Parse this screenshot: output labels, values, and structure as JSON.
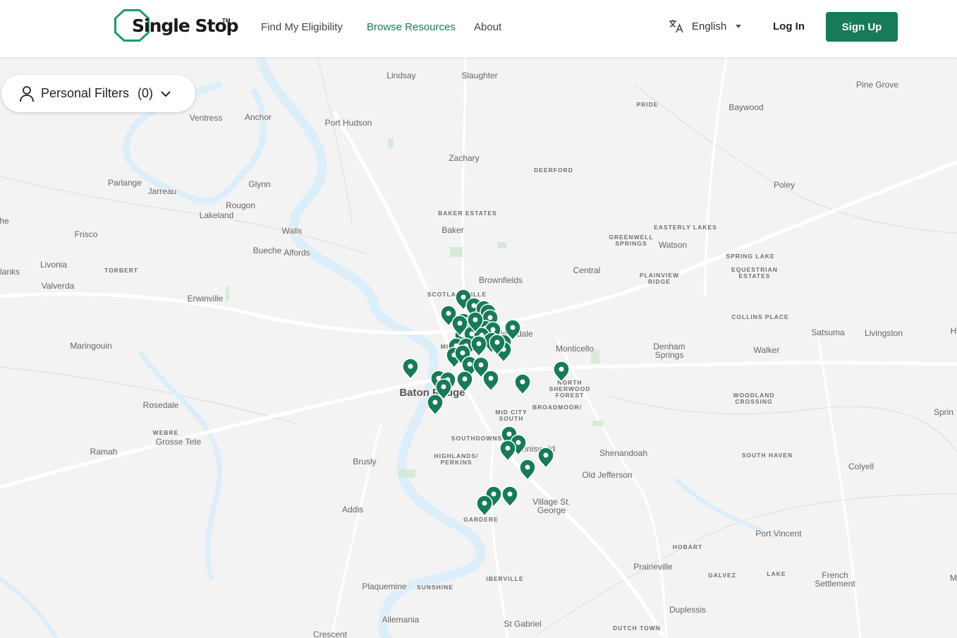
{
  "brand": {
    "name": "Single Stop",
    "tm": "TM"
  },
  "nav": [
    {
      "label": "Find My Eligibility"
    },
    {
      "label": "Browse Resources"
    },
    {
      "label": "About"
    }
  ],
  "language": {
    "label": "English",
    "icon": "translate-icon"
  },
  "auth": {
    "login": "Log In",
    "signup": "Sign Up"
  },
  "filters": {
    "label": "Personal Filters",
    "count": "(0)",
    "icon": "person-icon"
  },
  "colors": {
    "accent": "#177a58",
    "pin": "#177a58",
    "water": "#dbeefa",
    "land": "#f3f3f3",
    "road": "#ffffff"
  },
  "map": {
    "places": [
      {
        "name": "Lindsay",
        "kind": "town"
      },
      {
        "name": "Slaughter",
        "kind": "town"
      },
      {
        "name": "Pine Grove",
        "kind": "town"
      },
      {
        "name": "PRIDE",
        "kind": "area"
      },
      {
        "name": "Baywood",
        "kind": "town"
      },
      {
        "name": "Ventress",
        "kind": "town"
      },
      {
        "name": "Anchor",
        "kind": "town"
      },
      {
        "name": "Port Hudson",
        "kind": "town"
      },
      {
        "name": "Zachary",
        "kind": "town"
      },
      {
        "name": "DEERFORD",
        "kind": "area"
      },
      {
        "name": "Parlange",
        "kind": "town"
      },
      {
        "name": "Jarreau",
        "kind": "town"
      },
      {
        "name": "Glynn",
        "kind": "town"
      },
      {
        "name": "Poley",
        "kind": "town"
      },
      {
        "name": "Rougon",
        "kind": "town"
      },
      {
        "name": "Lakeland",
        "kind": "town"
      },
      {
        "name": "BAKER ESTATES",
        "kind": "area"
      },
      {
        "name": "he",
        "kind": "town"
      },
      {
        "name": "Frisco",
        "kind": "town"
      },
      {
        "name": "Walls",
        "kind": "town"
      },
      {
        "name": "Baker",
        "kind": "town"
      },
      {
        "name": "EASTERLY LAKES",
        "kind": "area"
      },
      {
        "name": "GREENWELL",
        "kind": "area"
      },
      {
        "name": "SPRINGS",
        "kind": "area"
      },
      {
        "name": "Watson",
        "kind": "town"
      },
      {
        "name": "Bueche",
        "kind": "town"
      },
      {
        "name": "Alfords",
        "kind": "town"
      },
      {
        "name": "SPRING LAKE",
        "kind": "area"
      },
      {
        "name": "Livonia",
        "kind": "town"
      },
      {
        "name": "lanks",
        "kind": "town"
      },
      {
        "name": "TORBERT",
        "kind": "area"
      },
      {
        "name": "Central",
        "kind": "town"
      },
      {
        "name": "EQUESTRIAN",
        "kind": "area"
      },
      {
        "name": "ESTATES",
        "kind": "area"
      },
      {
        "name": "Brownfields",
        "kind": "town"
      },
      {
        "name": "PLAINVIEW",
        "kind": "area"
      },
      {
        "name": "RIDGE",
        "kind": "area"
      },
      {
        "name": "Valverda",
        "kind": "town"
      },
      {
        "name": "SCOTLANDVILLE",
        "kind": "area"
      },
      {
        "name": "Erwinville",
        "kind": "town"
      },
      {
        "name": "COLLINS PLACE",
        "kind": "area"
      },
      {
        "name": "Satsuma",
        "kind": "town"
      },
      {
        "name": "Livingston",
        "kind": "town"
      },
      {
        "name": "H",
        "kind": "town"
      },
      {
        "name": "Merrydale",
        "kind": "town"
      },
      {
        "name": "Maringouin",
        "kind": "town"
      },
      {
        "name": "Monticello",
        "kind": "town"
      },
      {
        "name": "Denham",
        "kind": "town"
      },
      {
        "name": "Springs",
        "kind": "town"
      },
      {
        "name": "Walker",
        "kind": "town"
      },
      {
        "name": "MID",
        "kind": "area"
      },
      {
        "name": "NORTH",
        "kind": "area"
      },
      {
        "name": "SHERWOOD",
        "kind": "area"
      },
      {
        "name": "FOREST",
        "kind": "area"
      },
      {
        "name": "Baton Rouge",
        "kind": "city"
      },
      {
        "name": "WOODLAND",
        "kind": "area"
      },
      {
        "name": "CROSSING",
        "kind": "area"
      },
      {
        "name": "Rosedale",
        "kind": "town"
      },
      {
        "name": "MID CITY",
        "kind": "area"
      },
      {
        "name": "SOUTH",
        "kind": "area"
      },
      {
        "name": "BROADMOOR/",
        "kind": "area"
      },
      {
        "name": "Sprin",
        "kind": "town"
      },
      {
        "name": "WEBRE",
        "kind": "area"
      },
      {
        "name": "Grosse Tete",
        "kind": "town"
      },
      {
        "name": "SOUTHDOWNS",
        "kind": "area"
      },
      {
        "name": "Inniswold",
        "kind": "town"
      },
      {
        "name": "Ramah",
        "kind": "town"
      },
      {
        "name": "Shenandoah",
        "kind": "town"
      },
      {
        "name": "HIGHLANDS/",
        "kind": "area"
      },
      {
        "name": "PERKINS",
        "kind": "area"
      },
      {
        "name": "SOUTH HAVEN",
        "kind": "area"
      },
      {
        "name": "Brusly",
        "kind": "town"
      },
      {
        "name": "Colyell",
        "kind": "town"
      },
      {
        "name": "Old Jefferson",
        "kind": "town"
      },
      {
        "name": "Village St.",
        "kind": "town"
      },
      {
        "name": "George",
        "kind": "town"
      },
      {
        "name": "Addis",
        "kind": "town"
      },
      {
        "name": "GARDERE",
        "kind": "area"
      },
      {
        "name": "Port Vincent",
        "kind": "town"
      },
      {
        "name": "HOBART",
        "kind": "area"
      },
      {
        "name": "Prairieville",
        "kind": "town"
      },
      {
        "name": "GALVEZ",
        "kind": "area"
      },
      {
        "name": "LAKE",
        "kind": "area"
      },
      {
        "name": "French",
        "kind": "town"
      },
      {
        "name": "Settlement",
        "kind": "town"
      },
      {
        "name": "M",
        "kind": "town"
      },
      {
        "name": "IBERVILLE",
        "kind": "area"
      },
      {
        "name": "Plaquemine",
        "kind": "town"
      },
      {
        "name": "SUNSHINE",
        "kind": "area"
      },
      {
        "name": "Duplessis",
        "kind": "town"
      },
      {
        "name": "Allemania",
        "kind": "town"
      },
      {
        "name": "St Gabriel",
        "kind": "town"
      },
      {
        "name": "DUTCH TOWN",
        "kind": "area"
      },
      {
        "name": "Crescent",
        "kind": "town"
      }
    ],
    "pin_count": 46
  }
}
